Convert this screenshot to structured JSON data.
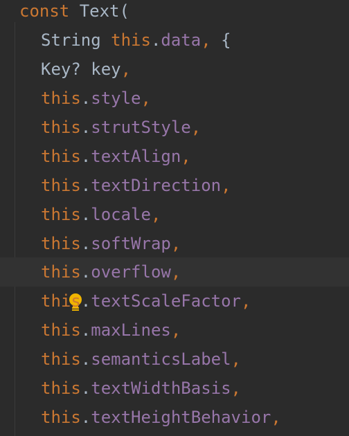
{
  "editor": {
    "lines": [
      {
        "tokens": [
          "const",
          " ",
          "Text",
          "("
        ]
      },
      {
        "tokens": [
          "String",
          " ",
          "this",
          ".",
          "data",
          ",",
          " {"
        ]
      },
      {
        "tokens": [
          "Key?",
          " ",
          "key",
          ","
        ]
      },
      {
        "tokens": [
          "this",
          ".",
          "style",
          ","
        ]
      },
      {
        "tokens": [
          "this",
          ".",
          "strutStyle",
          ","
        ]
      },
      {
        "tokens": [
          "this",
          ".",
          "textAlign",
          ","
        ]
      },
      {
        "tokens": [
          "this",
          ".",
          "textDirection",
          ","
        ]
      },
      {
        "tokens": [
          "this",
          ".",
          "locale",
          ","
        ]
      },
      {
        "tokens": [
          "this",
          ".",
          "softWrap",
          ","
        ]
      },
      {
        "tokens": [
          "this",
          ".",
          "overflow",
          ","
        ]
      },
      {
        "tokens": [
          "this",
          ".",
          "textScaleFactor",
          ","
        ]
      },
      {
        "tokens": [
          "this",
          ".",
          "maxLines",
          ","
        ]
      },
      {
        "tokens": [
          "this",
          ".",
          "semanticsLabel",
          ","
        ]
      },
      {
        "tokens": [
          "this",
          ".",
          "textWidthBasis",
          ","
        ]
      },
      {
        "tokens": [
          "this",
          ".",
          "textHeightBehavior",
          ","
        ]
      }
    ],
    "gutter_icon": "lightbulb-icon",
    "colors": {
      "background": "#2b2b2b",
      "current_line": "#323232",
      "keyword": "#cc7832",
      "property": "#9876aa",
      "plain": "#a9b7c6",
      "bulb": "#f0b400"
    }
  }
}
